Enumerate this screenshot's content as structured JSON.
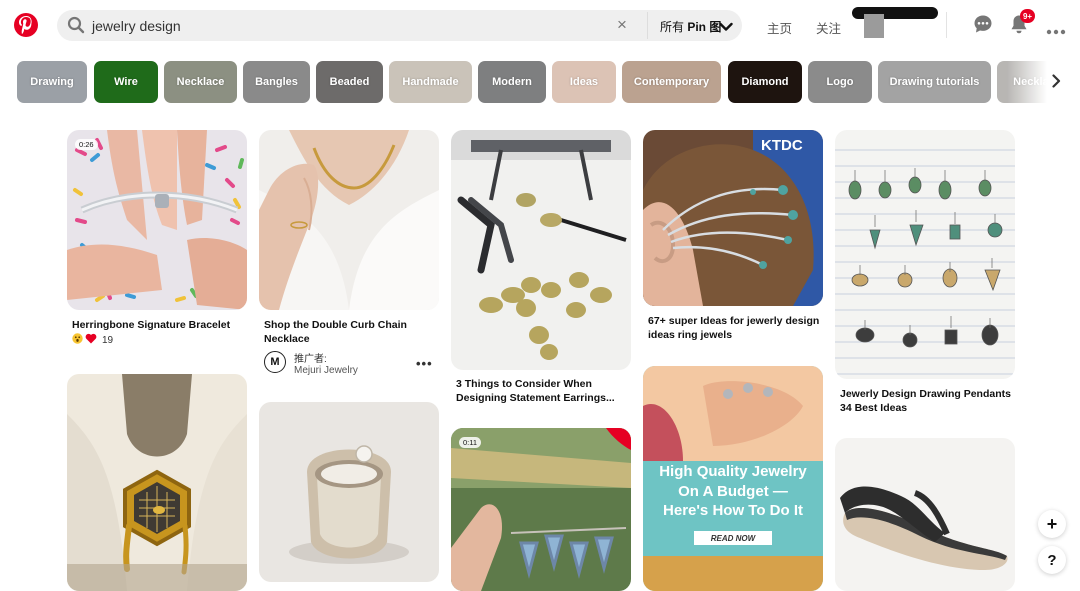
{
  "header": {
    "search": {
      "query": "jewelry design",
      "clear_icon": "×",
      "scope_prefix": "所有 ",
      "scope_bold": "Pin 图"
    },
    "nav": {
      "home": "主页",
      "following": "关注"
    },
    "notifications_badge": "9+"
  },
  "chips": [
    {
      "label": "Drawing",
      "color": "#9ba0a6"
    },
    {
      "label": "Wire",
      "color": "#1f6b1a"
    },
    {
      "label": "Necklace",
      "color": "#8c9082"
    },
    {
      "label": "Bangles",
      "color": "#8a8a8a"
    },
    {
      "label": "Beaded",
      "color": "#6d6b6a"
    },
    {
      "label": "Handmade",
      "color": "#cac3b9"
    },
    {
      "label": "Modern",
      "color": "#7e7f80"
    },
    {
      "label": "Ideas",
      "color": "#dcc3b5"
    },
    {
      "label": "Contemporary",
      "color": "#bba290"
    },
    {
      "label": "Diamond",
      "color": "#1e140f"
    },
    {
      "label": "Logo",
      "color": "#8b8b8b"
    },
    {
      "label": "Drawing tutorials",
      "color": "#a3a3a3"
    },
    {
      "label": "Necklace",
      "color": "#b8b6b3"
    }
  ],
  "pins": {
    "p1": {
      "title": "Herringbone Signature Bracelet",
      "duration": "0:26",
      "reaction_count": "19"
    },
    "p2": {
      "title_line1": "Shop the Double Curb Chain",
      "title_line2": "Necklace",
      "promoted_label": "推广者:",
      "promoter": "Mejuri Jewelry",
      "more": "•••"
    },
    "p3": {
      "title_line1": "3 Things to Consider When",
      "title_line2": "Designing Statement Earrings..."
    },
    "p4": {
      "title_line1": "67+ super Ideas for jewerly design",
      "title_line2": "ideas ring jewels",
      "sign": "KTDC"
    },
    "p5": {
      "title_line1": "Jewerly Design Drawing Pendants",
      "title_line2": "34 Best Ideas"
    },
    "p6": {},
    "p7": {},
    "p8": {
      "duration": "0:11"
    },
    "p9": {
      "ad_line1": "High Quality Jewelry",
      "ad_line2": "On A Budget —",
      "ad_line3": "Here's How To Do It",
      "cta": "READ NOW"
    },
    "p10": {}
  },
  "fab": {
    "plus": "+",
    "help": "?"
  }
}
